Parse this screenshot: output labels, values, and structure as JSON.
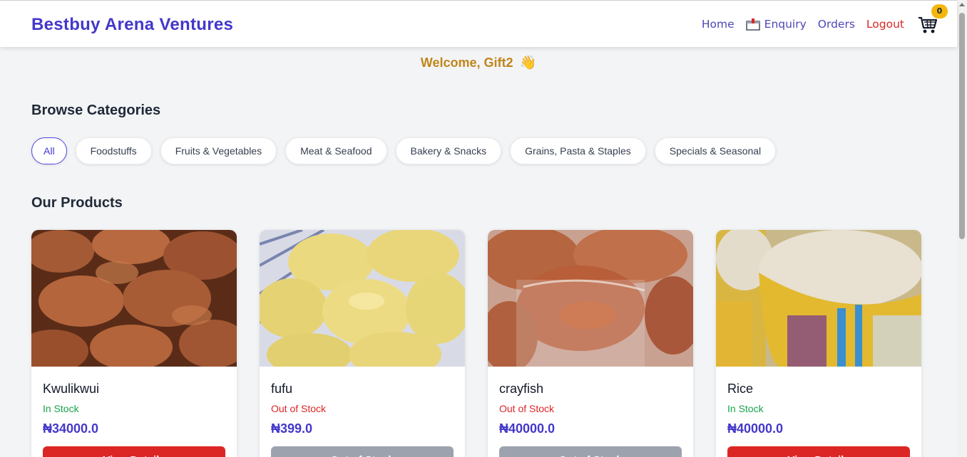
{
  "brand": "Bestbuy Arena Ventures",
  "nav": {
    "home": "Home",
    "enquiry": "Enquiry",
    "orders": "Orders",
    "logout": "Logout",
    "cart_count": "0"
  },
  "welcome": {
    "text": "Welcome, Gift2",
    "emoji": "👋"
  },
  "categories": {
    "title": "Browse Categories",
    "items": [
      "All",
      "Foodstuffs",
      "Fruits & Vegetables",
      "Meat & Seafood",
      "Bakery & Snacks",
      "Grains, Pasta & Staples",
      "Specials & Seasonal"
    ],
    "selected": "All"
  },
  "products": {
    "title": "Our Products",
    "items": [
      {
        "name": "Kwulikwui",
        "stock": "In Stock",
        "price": "₦34000.0",
        "button": "View Details",
        "image": "kwulikwui-photo"
      },
      {
        "name": "fufu",
        "stock": "Out of Stock",
        "price": "₦399.0",
        "button": "Out of Stock",
        "image": "fufu-photo"
      },
      {
        "name": "crayfish",
        "stock": "Out of Stock",
        "price": "₦40000.0",
        "button": "Out of Stock",
        "image": "crayfish-photo"
      },
      {
        "name": "Rice",
        "stock": "In Stock",
        "price": "₦40000.0",
        "button": "View Details",
        "image": "rice-photo"
      }
    ]
  },
  "colors": {
    "brand": "#4338ca",
    "in_stock": "#16a34a",
    "out_of_stock": "#dc2626",
    "cart_badge": "#f5b60c",
    "welcome": "#c0851a"
  }
}
